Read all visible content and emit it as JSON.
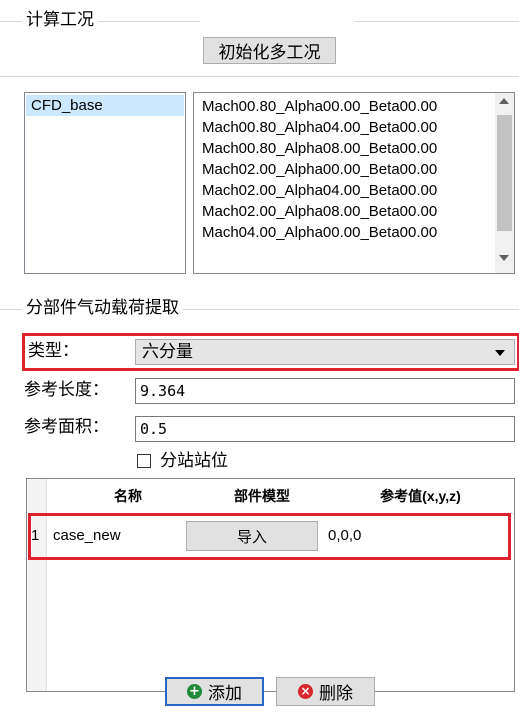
{
  "calc_section": {
    "title": "计算工况",
    "init_button": "初始化多工况",
    "configs": [
      "CFD_base"
    ],
    "conditions": [
      "Mach00.80_Alpha00.00_Beta00.00",
      "Mach00.80_Alpha04.00_Beta00.00",
      "Mach00.80_Alpha08.00_Beta00.00",
      "Mach02.00_Alpha00.00_Beta00.00",
      "Mach02.00_Alpha04.00_Beta00.00",
      "Mach02.00_Alpha08.00_Beta00.00",
      "Mach04.00_Alpha00.00_Beta00.00"
    ]
  },
  "load_section": {
    "title": "分部件气动载荷提取",
    "type_label": "类型：",
    "type_value": "六分量",
    "ref_length_label": "参考长度：",
    "ref_length_value": "9.364",
    "ref_area_label": "参考面积：",
    "ref_area_value": "0.5",
    "station_checkbox_label": "分站站位",
    "station_checked": false
  },
  "table": {
    "headers": [
      "名称",
      "部件模型",
      "参考值(x,y,z)"
    ],
    "rows": [
      {
        "index": "1",
        "name": "case_new",
        "model_button": "导入",
        "ref_value": "0,0,0"
      }
    ]
  },
  "actions": {
    "add_label": "添加",
    "delete_label": "删除"
  },
  "colors": {
    "highlight": "#e0212e",
    "add_icon": "#1f8a3a",
    "delete_icon": "#d9262e",
    "add_border": "#2a64c6"
  }
}
